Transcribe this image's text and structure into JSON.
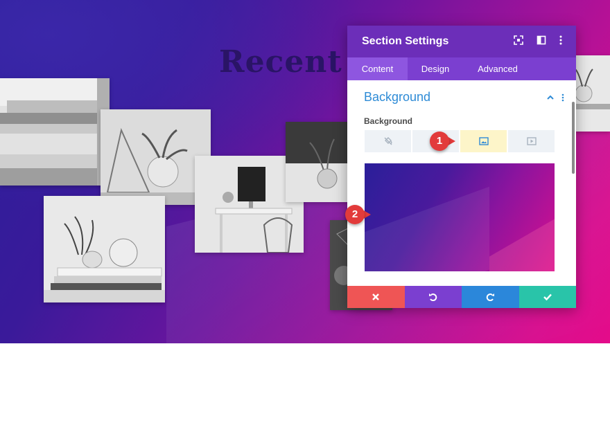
{
  "background_title": "Recent W",
  "panel": {
    "title": "Section Settings",
    "tabs": [
      {
        "label": "Content",
        "active": true
      },
      {
        "label": "Design",
        "active": false
      },
      {
        "label": "Advanced",
        "active": false
      }
    ],
    "section_title": "Background",
    "field_label": "Background",
    "background_types": [
      {
        "icon": "no-background-icon",
        "active": false
      },
      {
        "icon": "gradient-icon",
        "active": false
      },
      {
        "icon": "image-icon",
        "active": true
      },
      {
        "icon": "video-icon",
        "active": false
      }
    ],
    "footer_colors": {
      "cancel": "#ef5555",
      "undo": "#7b3fd0",
      "redo": "#2b87da",
      "save": "#29c4a9"
    }
  },
  "callouts": [
    "1",
    "2"
  ],
  "colors": {
    "header": "#6c2eb9",
    "tabs": "#7b3fd0",
    "accent": "#2e8bd6",
    "callout": "#e23b3b"
  }
}
